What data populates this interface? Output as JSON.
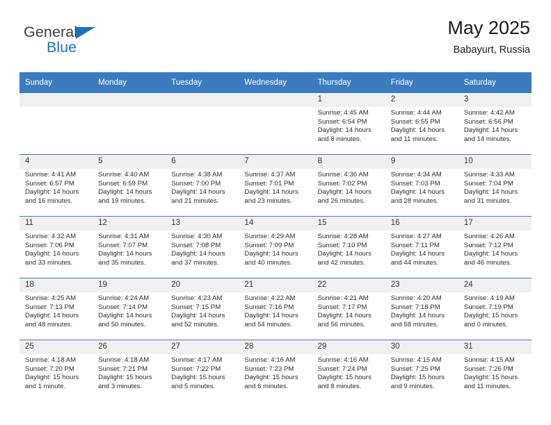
{
  "brand": {
    "name_part1": "General",
    "name_part2": "Blue",
    "triangle_color": "#1b72bf"
  },
  "header": {
    "title": "May 2025",
    "subtitle": "Babayurt, Russia"
  },
  "theme": {
    "header_row_bg": "#3b7cc0",
    "header_row_text": "#ffffff",
    "daynum_band_bg": "#f0f0f0",
    "row_divider": "#3b7cc0",
    "page_bg": "#ffffff"
  },
  "weekdays": [
    "Sunday",
    "Monday",
    "Tuesday",
    "Wednesday",
    "Thursday",
    "Friday",
    "Saturday"
  ],
  "weeks": [
    [
      {
        "day": "",
        "lines": []
      },
      {
        "day": "",
        "lines": []
      },
      {
        "day": "",
        "lines": []
      },
      {
        "day": "",
        "lines": []
      },
      {
        "day": "1",
        "lines": [
          "Sunrise: 4:45 AM",
          "Sunset: 6:54 PM",
          "Daylight: 14 hours",
          "and 8 minutes."
        ]
      },
      {
        "day": "2",
        "lines": [
          "Sunrise: 4:44 AM",
          "Sunset: 6:55 PM",
          "Daylight: 14 hours",
          "and 11 minutes."
        ]
      },
      {
        "day": "3",
        "lines": [
          "Sunrise: 4:42 AM",
          "Sunset: 6:56 PM",
          "Daylight: 14 hours",
          "and 14 minutes."
        ]
      }
    ],
    [
      {
        "day": "4",
        "lines": [
          "Sunrise: 4:41 AM",
          "Sunset: 6:57 PM",
          "Daylight: 14 hours",
          "and 16 minutes."
        ]
      },
      {
        "day": "5",
        "lines": [
          "Sunrise: 4:40 AM",
          "Sunset: 6:59 PM",
          "Daylight: 14 hours",
          "and 19 minutes."
        ]
      },
      {
        "day": "6",
        "lines": [
          "Sunrise: 4:38 AM",
          "Sunset: 7:00 PM",
          "Daylight: 14 hours",
          "and 21 minutes."
        ]
      },
      {
        "day": "7",
        "lines": [
          "Sunrise: 4:37 AM",
          "Sunset: 7:01 PM",
          "Daylight: 14 hours",
          "and 23 minutes."
        ]
      },
      {
        "day": "8",
        "lines": [
          "Sunrise: 4:36 AM",
          "Sunset: 7:02 PM",
          "Daylight: 14 hours",
          "and 26 minutes."
        ]
      },
      {
        "day": "9",
        "lines": [
          "Sunrise: 4:34 AM",
          "Sunset: 7:03 PM",
          "Daylight: 14 hours",
          "and 28 minutes."
        ]
      },
      {
        "day": "10",
        "lines": [
          "Sunrise: 4:33 AM",
          "Sunset: 7:04 PM",
          "Daylight: 14 hours",
          "and 31 minutes."
        ]
      }
    ],
    [
      {
        "day": "11",
        "lines": [
          "Sunrise: 4:32 AM",
          "Sunset: 7:06 PM",
          "Daylight: 14 hours",
          "and 33 minutes."
        ]
      },
      {
        "day": "12",
        "lines": [
          "Sunrise: 4:31 AM",
          "Sunset: 7:07 PM",
          "Daylight: 14 hours",
          "and 35 minutes."
        ]
      },
      {
        "day": "13",
        "lines": [
          "Sunrise: 4:30 AM",
          "Sunset: 7:08 PM",
          "Daylight: 14 hours",
          "and 37 minutes."
        ]
      },
      {
        "day": "14",
        "lines": [
          "Sunrise: 4:29 AM",
          "Sunset: 7:09 PM",
          "Daylight: 14 hours",
          "and 40 minutes."
        ]
      },
      {
        "day": "15",
        "lines": [
          "Sunrise: 4:28 AM",
          "Sunset: 7:10 PM",
          "Daylight: 14 hours",
          "and 42 minutes."
        ]
      },
      {
        "day": "16",
        "lines": [
          "Sunrise: 4:27 AM",
          "Sunset: 7:11 PM",
          "Daylight: 14 hours",
          "and 44 minutes."
        ]
      },
      {
        "day": "17",
        "lines": [
          "Sunrise: 4:26 AM",
          "Sunset: 7:12 PM",
          "Daylight: 14 hours",
          "and 46 minutes."
        ]
      }
    ],
    [
      {
        "day": "18",
        "lines": [
          "Sunrise: 4:25 AM",
          "Sunset: 7:13 PM",
          "Daylight: 14 hours",
          "and 48 minutes."
        ]
      },
      {
        "day": "19",
        "lines": [
          "Sunrise: 4:24 AM",
          "Sunset: 7:14 PM",
          "Daylight: 14 hours",
          "and 50 minutes."
        ]
      },
      {
        "day": "20",
        "lines": [
          "Sunrise: 4:23 AM",
          "Sunset: 7:15 PM",
          "Daylight: 14 hours",
          "and 52 minutes."
        ]
      },
      {
        "day": "21",
        "lines": [
          "Sunrise: 4:22 AM",
          "Sunset: 7:16 PM",
          "Daylight: 14 hours",
          "and 54 minutes."
        ]
      },
      {
        "day": "22",
        "lines": [
          "Sunrise: 4:21 AM",
          "Sunset: 7:17 PM",
          "Daylight: 14 hours",
          "and 56 minutes."
        ]
      },
      {
        "day": "23",
        "lines": [
          "Sunrise: 4:20 AM",
          "Sunset: 7:18 PM",
          "Daylight: 14 hours",
          "and 58 minutes."
        ]
      },
      {
        "day": "24",
        "lines": [
          "Sunrise: 4:19 AM",
          "Sunset: 7:19 PM",
          "Daylight: 15 hours",
          "and 0 minutes."
        ]
      }
    ],
    [
      {
        "day": "25",
        "lines": [
          "Sunrise: 4:18 AM",
          "Sunset: 7:20 PM",
          "Daylight: 15 hours",
          "and 1 minute."
        ]
      },
      {
        "day": "26",
        "lines": [
          "Sunrise: 4:18 AM",
          "Sunset: 7:21 PM",
          "Daylight: 15 hours",
          "and 3 minutes."
        ]
      },
      {
        "day": "27",
        "lines": [
          "Sunrise: 4:17 AM",
          "Sunset: 7:22 PM",
          "Daylight: 15 hours",
          "and 5 minutes."
        ]
      },
      {
        "day": "28",
        "lines": [
          "Sunrise: 4:16 AM",
          "Sunset: 7:23 PM",
          "Daylight: 15 hours",
          "and 6 minutes."
        ]
      },
      {
        "day": "29",
        "lines": [
          "Sunrise: 4:16 AM",
          "Sunset: 7:24 PM",
          "Daylight: 15 hours",
          "and 8 minutes."
        ]
      },
      {
        "day": "30",
        "lines": [
          "Sunrise: 4:15 AM",
          "Sunset: 7:25 PM",
          "Daylight: 15 hours",
          "and 9 minutes."
        ]
      },
      {
        "day": "31",
        "lines": [
          "Sunrise: 4:15 AM",
          "Sunset: 7:26 PM",
          "Daylight: 15 hours",
          "and 11 minutes."
        ]
      }
    ]
  ]
}
